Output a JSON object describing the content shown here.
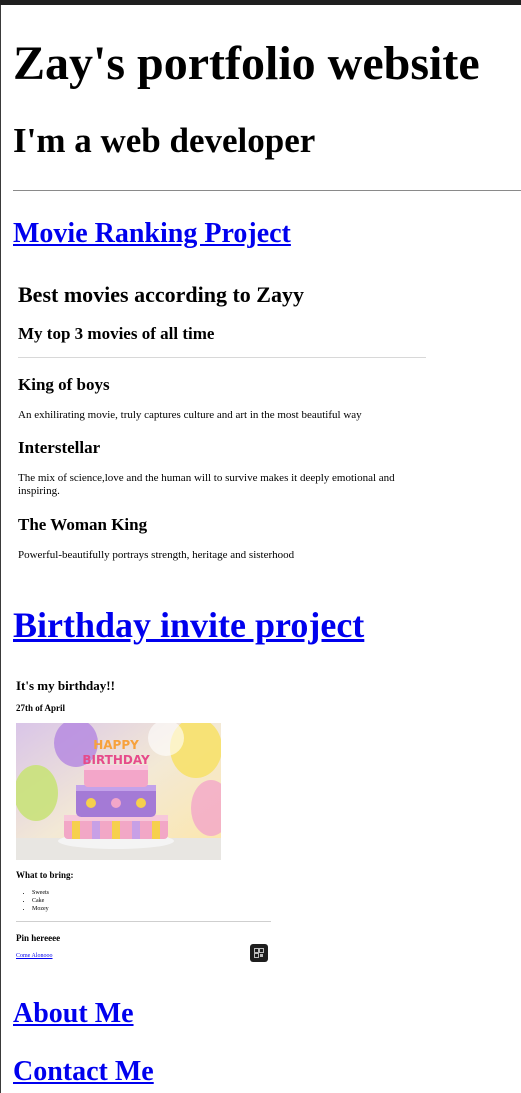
{
  "header": {
    "title": "Zay's portfolio website",
    "subtitle": "I'm a web developer"
  },
  "projects": {
    "movie": {
      "link_label": "Movie Ranking Project",
      "embed": {
        "title": "Best movies according to Zayy",
        "subtitle": "My top 3 movies of all time",
        "movies": [
          {
            "name": "King of boys",
            "description": "An exhilirating movie, truly captures culture and art in the most beautiful way"
          },
          {
            "name": "Interstellar",
            "description": "The mix of science,love and the human will to survive makes it deeply emotional and inspiring."
          },
          {
            "name": "The Woman King",
            "description": "Powerful-beautifully portrays strength, heritage and sisterhood"
          }
        ]
      }
    },
    "birthday": {
      "link_label": "Birthday invite project",
      "embed": {
        "heading": "It's my birthday!!",
        "date": "27th of April",
        "cake_text_1": "HAPPY",
        "cake_text_2": "BIRTHDAY",
        "bring_heading": "What to bring:",
        "bring_items": [
          "Sweets",
          "Cake",
          "Mozey"
        ],
        "pin_heading": "Pin hereeee",
        "come_link": "Come Alonooo"
      }
    }
  },
  "nav": {
    "about_label": "About Me",
    "contact_label": "Contact Me"
  },
  "colors": {
    "link": "#0000ee",
    "top_bar": "#1f1f1f"
  }
}
